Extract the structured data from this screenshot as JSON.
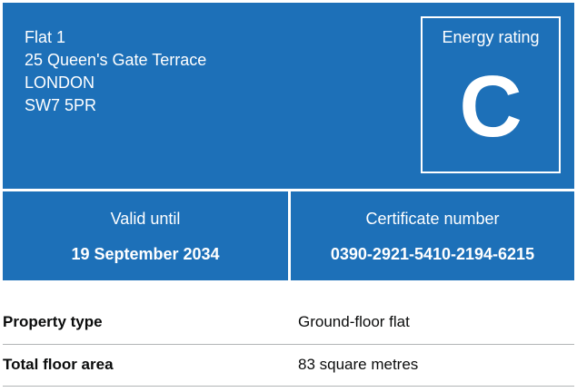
{
  "address": {
    "line1": "Flat 1",
    "line2": "25 Queen's Gate Terrace",
    "line3": "LONDON",
    "postcode": "SW7 5PR"
  },
  "rating": {
    "label": "Energy rating",
    "letter": "C"
  },
  "valid_until": {
    "label": "Valid until",
    "value": "19 September 2034"
  },
  "certificate": {
    "label": "Certificate number",
    "value": "0390-2921-5410-2194-6215"
  },
  "summary": [
    {
      "key": "Property type",
      "value": "Ground-floor flat"
    },
    {
      "key": "Total floor area",
      "value": "83 square metres"
    }
  ],
  "colors": {
    "panel_blue": "#1d70b8",
    "divider_grey": "#b1b4b6",
    "text": "#0b0c0c"
  }
}
